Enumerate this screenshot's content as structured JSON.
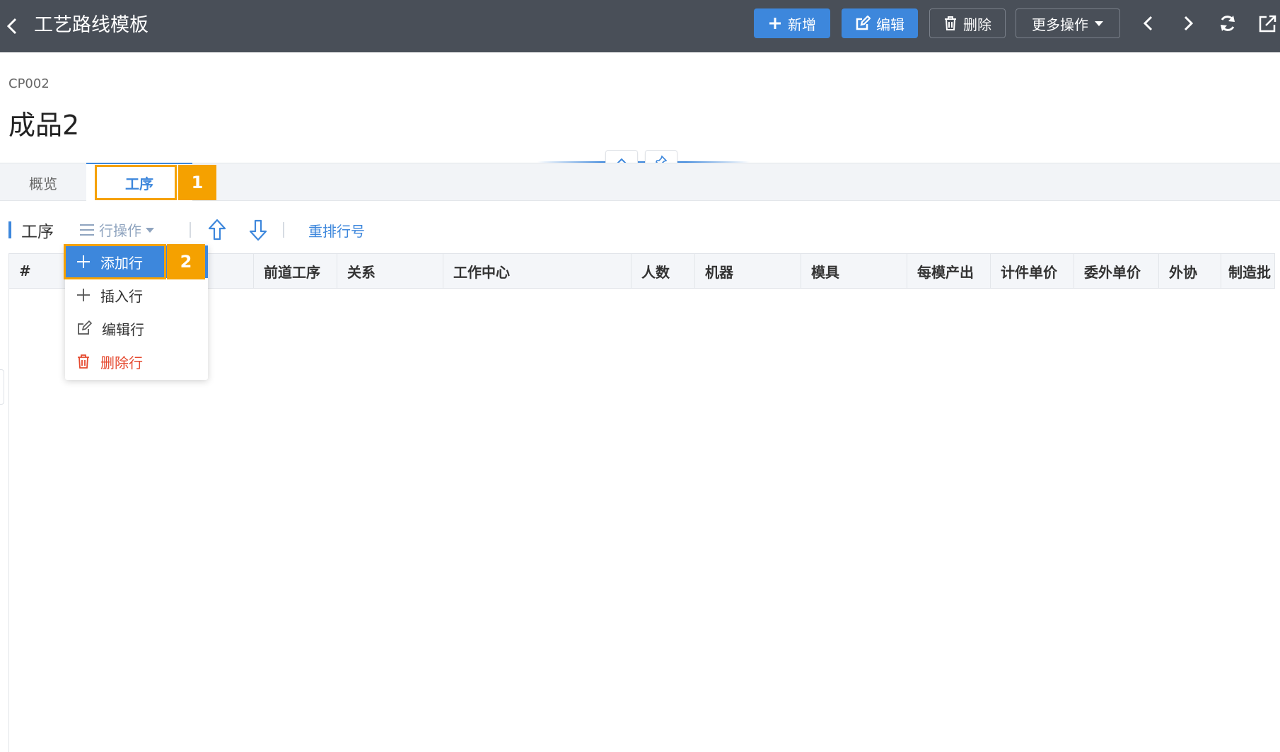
{
  "header": {
    "title": "工艺路线模板",
    "buttons": {
      "new": "新增",
      "edit": "编辑",
      "delete": "删除",
      "more": "更多操作"
    },
    "colors": {
      "bar": "#494f58",
      "primary": "#3d87dc"
    },
    "icons": [
      "back-icon",
      "plus-icon",
      "edit-icon",
      "trash-icon",
      "caret-down-icon",
      "prev-icon",
      "next-icon",
      "refresh-icon",
      "open-external-icon"
    ]
  },
  "record": {
    "code": "CP002",
    "name": "成品2"
  },
  "tabs": [
    {
      "label": "概览"
    },
    {
      "label": "工序",
      "active": true
    }
  ],
  "annotations": [
    "1",
    "2"
  ],
  "section": {
    "title": "工序",
    "row_ops_label": "行操作",
    "renumber_label": "重排行号"
  },
  "menu": {
    "items": [
      {
        "label": "添加行",
        "icon": "plus-icon"
      },
      {
        "label": "插入行",
        "icon": "plus-icon"
      },
      {
        "label": "编辑行",
        "icon": "edit-icon"
      },
      {
        "label": "删除行",
        "icon": "trash-icon"
      }
    ]
  },
  "table": {
    "columns": [
      "#",
      "前道工序",
      "关系",
      "工作中心",
      "人数",
      "机器",
      "模具",
      "每模产出",
      "计件单价",
      "委外单价",
      "外协",
      "制造批"
    ]
  }
}
